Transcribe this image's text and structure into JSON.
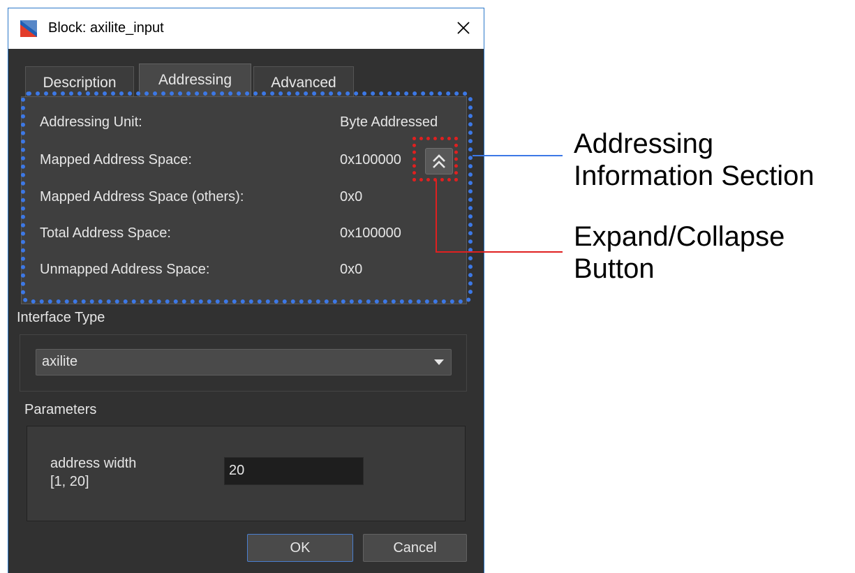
{
  "window": {
    "title": "Block: axilite_input",
    "close_icon": "close-icon"
  },
  "tabs": [
    {
      "label": "Description",
      "active": false
    },
    {
      "label": "Addressing",
      "active": true
    },
    {
      "label": "Advanced",
      "active": false
    }
  ],
  "addressing": {
    "rows": [
      {
        "label": "Addressing Unit:",
        "value": "Byte Addressed"
      },
      {
        "label": "Mapped Address Space:",
        "value": "0x100000"
      },
      {
        "label": "Mapped Address Space (others):",
        "value": "0x0"
      },
      {
        "label": "Total Address Space:",
        "value": "0x100000"
      },
      {
        "label": "Unmapped Address Space:",
        "value": "0x0"
      }
    ],
    "collapse_icon": "double-chevron-up-icon"
  },
  "interface": {
    "label": "Interface Type",
    "selected": "axilite"
  },
  "parameters": {
    "label": "Parameters",
    "address_width_label": "address width",
    "address_width_range": "[1, 20]",
    "address_width_value": "20"
  },
  "buttons": {
    "ok": "OK",
    "cancel": "Cancel"
  },
  "callouts": {
    "section_line1": "Addressing",
    "section_line2": "Information Section",
    "button_line1": "Expand/Collapse",
    "button_line2": "Button"
  },
  "colors": {
    "section_highlight": "#3c78e6",
    "button_highlight": "#e02020"
  }
}
